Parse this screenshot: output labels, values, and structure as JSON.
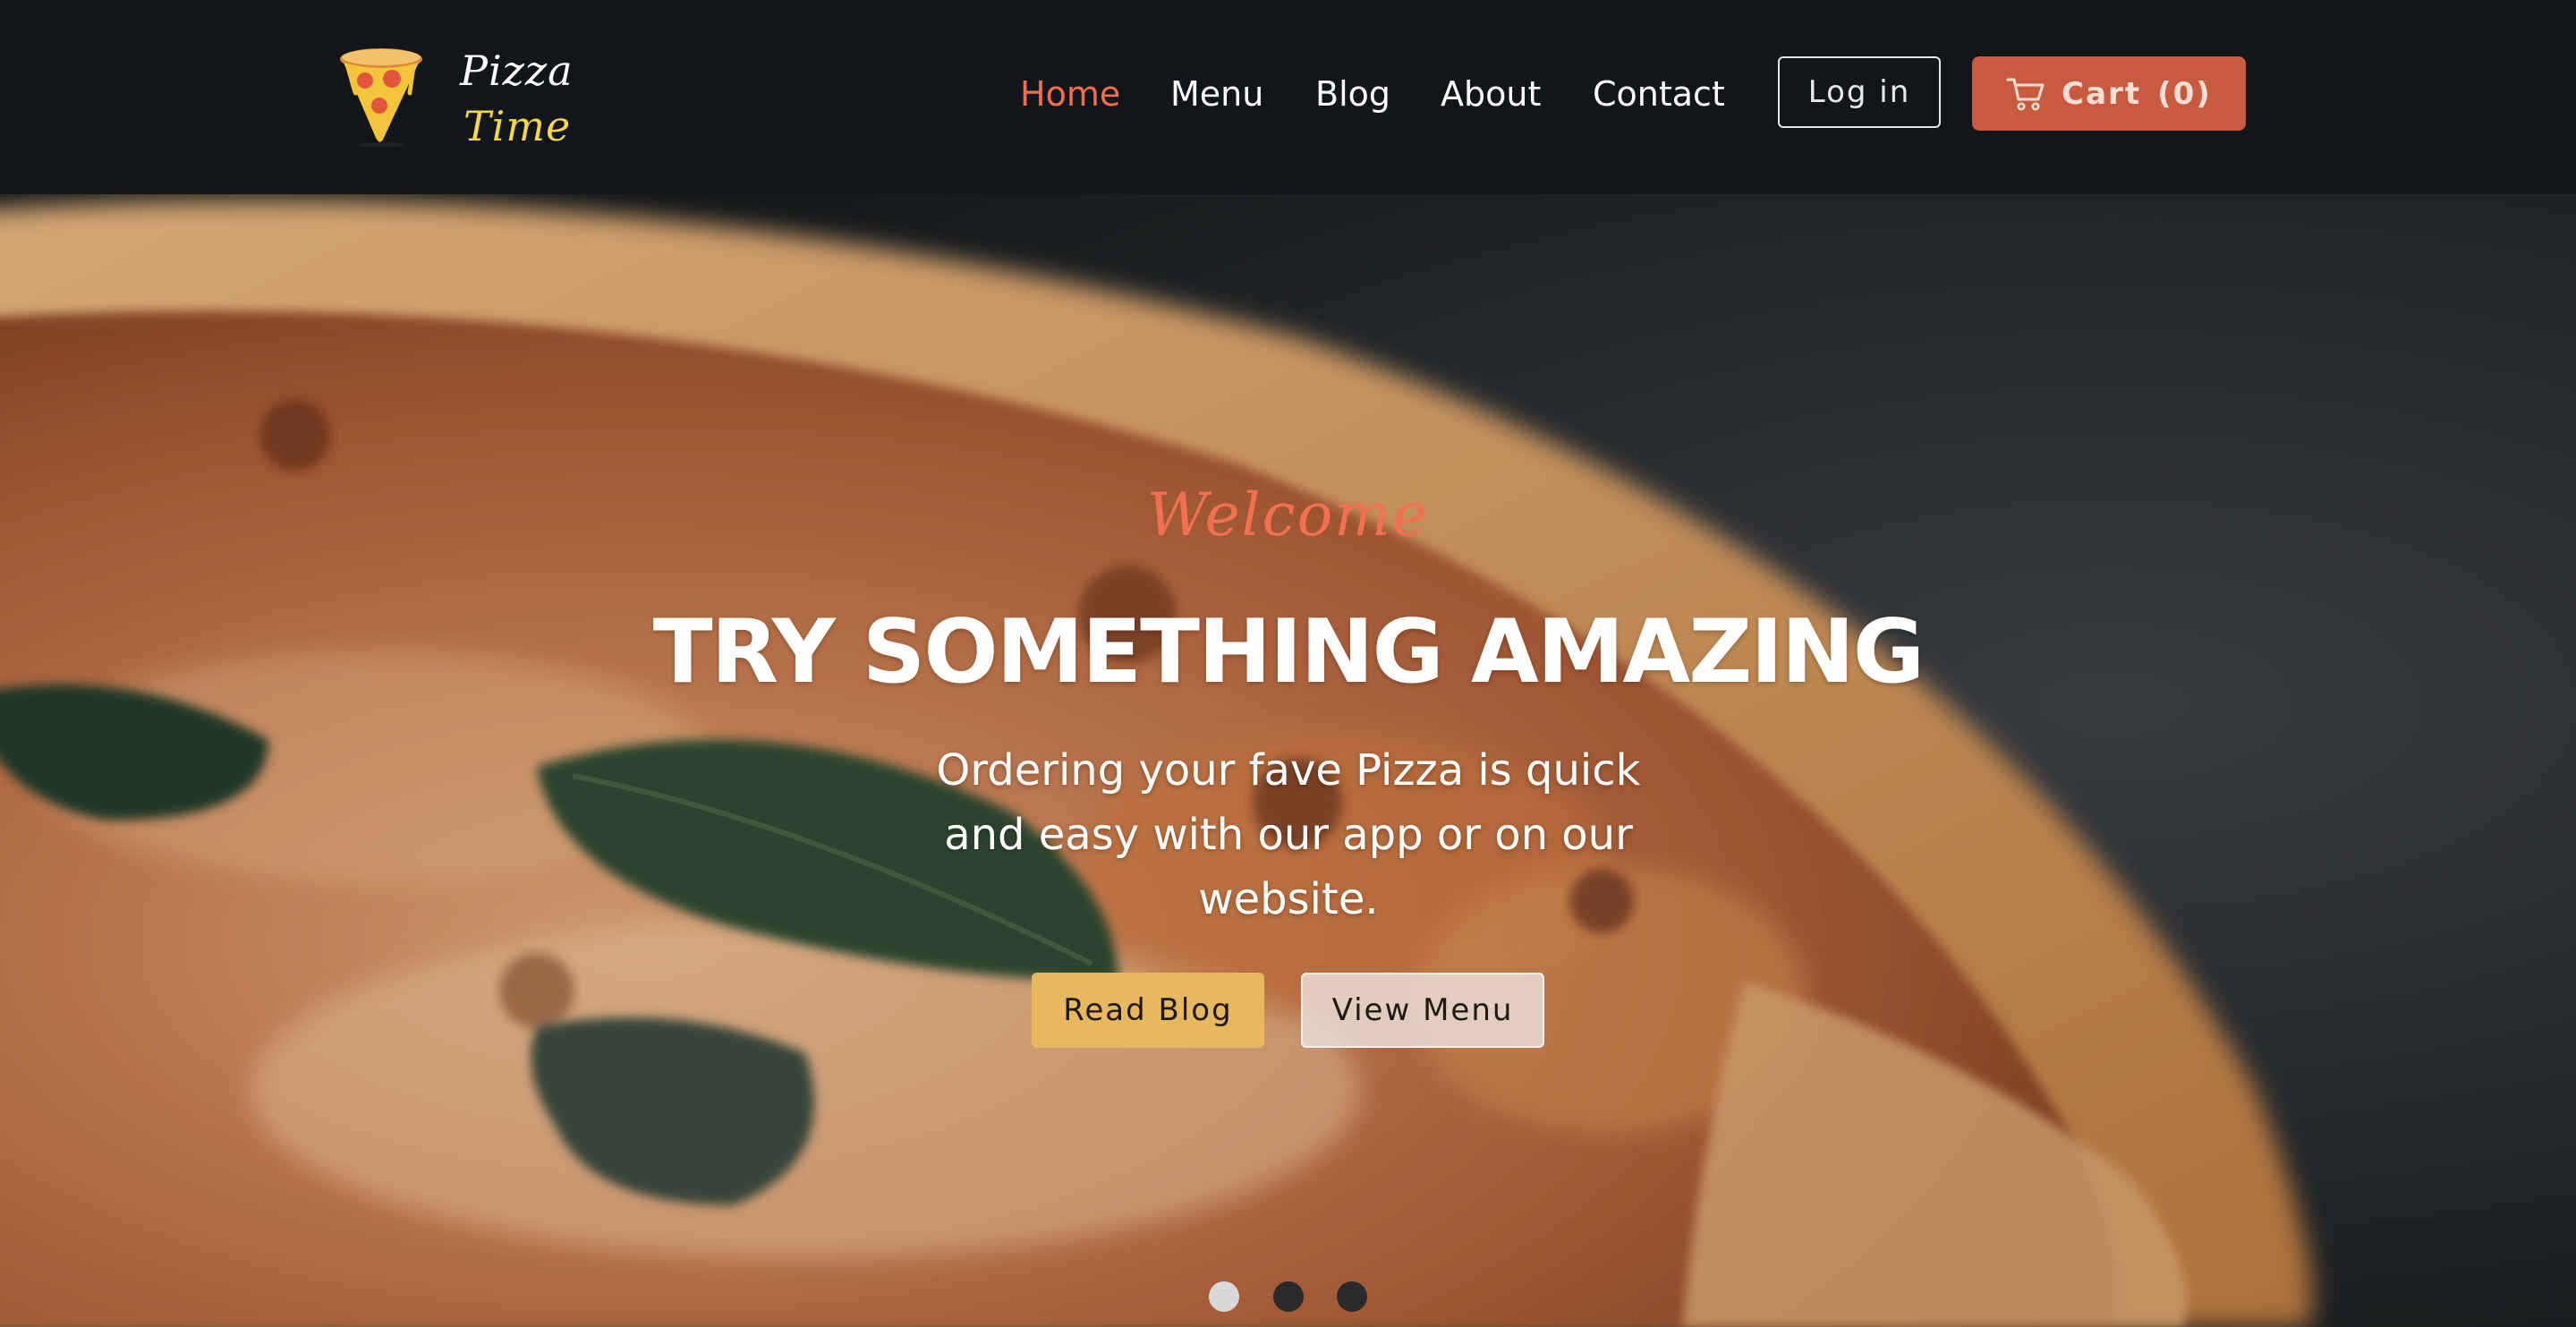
{
  "brand": {
    "name_line1": "Pizza",
    "name_line2": "Time",
    "logo_icon": "pizza-slice-icon",
    "accent_color": "#ef6f4f",
    "cart_color": "#c85a3f"
  },
  "nav": {
    "items": [
      {
        "label": "Home",
        "active": true
      },
      {
        "label": "Menu",
        "active": false
      },
      {
        "label": "Blog",
        "active": false
      },
      {
        "label": "About",
        "active": false
      },
      {
        "label": "Contact",
        "active": false
      }
    ],
    "login_label": "Log in",
    "cart_label": "Cart",
    "cart_count": "(0)",
    "cart_icon": "shopping-cart-icon"
  },
  "hero": {
    "welcome": "Welcome",
    "headline": "TRY SOMETHING AMAZING",
    "subtext": "Ordering your fave Pizza is quick and easy with our app or on our website.",
    "buttons": {
      "read_blog": "Read Blog",
      "view_menu": "View Menu"
    },
    "background": "pizza-photo",
    "carousel": {
      "slides": 3,
      "active_slide": 1
    }
  }
}
